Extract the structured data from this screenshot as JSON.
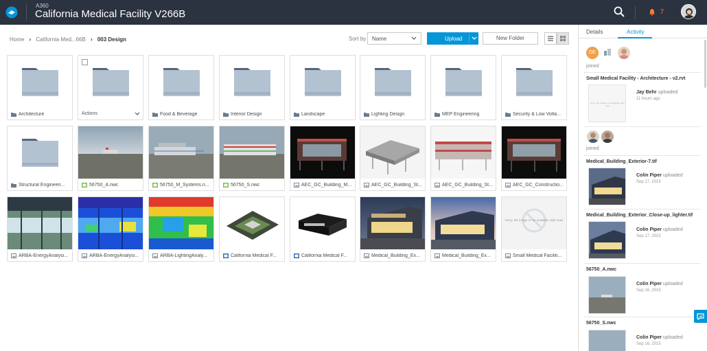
{
  "header": {
    "app_name": "A360",
    "project_title": "California Medical Facility V266B",
    "notification_count": "7"
  },
  "toolbar": {
    "breadcrumb": [
      "Home",
      "California Med...66B",
      "003 Design"
    ],
    "sort_label": "Sort by",
    "sort_value": "Name",
    "upload_label": "Upload",
    "new_folder_label": "New Folder"
  },
  "folders_row": [
    {
      "name": "Architecture"
    },
    {
      "name": "Actions"
    },
    {
      "name": "Food & Beverage"
    },
    {
      "name": "Interior Design"
    },
    {
      "name": "Landscape"
    },
    {
      "name": "Lighting Design"
    },
    {
      "name": "MEP Engineering"
    },
    {
      "name": "Security & Low Volta..."
    }
  ],
  "files_row2": [
    {
      "name": "Structural Engineeri..."
    },
    {
      "name": "56750_A.nwc"
    },
    {
      "name": "56750_M_Systems.n..."
    },
    {
      "name": "56750_S.nwc"
    },
    {
      "name": "AEC_GC_Building_M..."
    },
    {
      "name": "AEC_GC_Building_St..."
    },
    {
      "name": "AEC_GC_Building_St..."
    },
    {
      "name": "AEC_GC_Constructio..."
    }
  ],
  "files_row3": [
    {
      "name": "ARBA-EnergyAnalysi..."
    },
    {
      "name": "ARBA-EnergyAnalysi..."
    },
    {
      "name": "ARBA-LightingAnaly..."
    },
    {
      "name": "California Medical F..."
    },
    {
      "name": "California Medical F..."
    },
    {
      "name": "Medical_Building_Ex..."
    },
    {
      "name": "Medical_Building_Ex..."
    },
    {
      "name": "Small Medical Faciliti..."
    }
  ],
  "unavailable_text": "Sorry, the image is not available right now!",
  "panel": {
    "tab_details": "Details",
    "tab_activity": "Activity",
    "joined_initials": "DE",
    "joined_text": "joined",
    "joined_text2": "joined",
    "feed": [
      {
        "title": "Small Medical Facility - Architecture - v2.rvt",
        "user": "Jay Behr",
        "action": "uploaded",
        "time": "11 hours ago"
      },
      {
        "title": "Medical_Building_Exterior-7.tif",
        "user": "Colin Piper",
        "action": "uploaded",
        "time": "Sep 17, 2015"
      },
      {
        "title": "Medical_Building_Exterior_Close-up_lighter.tif",
        "user": "Colin Piper",
        "action": "uploaded",
        "time": "Sep 17, 2015"
      },
      {
        "title": "56750_A.nwc",
        "user": "Colin Piper",
        "action": "uploaded",
        "time": "Sep 16, 2015"
      },
      {
        "title": "56750_S.nwc",
        "user": "Colin Piper",
        "action": "uploaded",
        "time": "Sep 16, 2015"
      }
    ]
  }
}
